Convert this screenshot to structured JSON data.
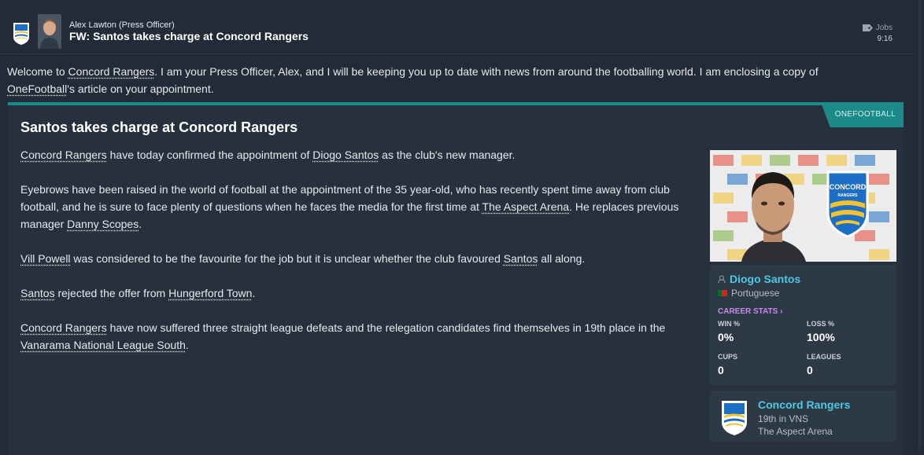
{
  "header": {
    "sender": "Alex Lawton  (Press Officer)",
    "subject": "FW: Santos takes charge at Concord Rangers",
    "jobs_label": "Jobs",
    "time": "9:16"
  },
  "intro": {
    "t1": "Welcome to ",
    "club": "Concord Rangers",
    "t2": ". I am your Press Officer, Alex, and I will be keeping you up to date with news from around the footballing world. I am enclosing a copy of ",
    "source": "OneFootball",
    "t3": "'s article on your appointment."
  },
  "article": {
    "source_tag": "ONEFOOTBALL",
    "title": "Santos takes charge at Concord Rangers",
    "p1": {
      "club": "Concord Rangers",
      "a": " have today confirmed the appointment of ",
      "manager": "Diogo Santos",
      "b": " as the club's new manager."
    },
    "p2": {
      "a": "Eyebrows have been raised in the world of football at the appointment of the 35 year-old, who has recently spent time away from club football, and he is sure to face plenty of questions when he faces the media for the first time at ",
      "stadium": "The Aspect Arena",
      "b": ". He replaces previous manager ",
      "prev": "Danny Scopes",
      "c": "."
    },
    "p3": {
      "person": "Vill Powell",
      "a": " was considered to be the favourite for the job but it is unclear whether the club favoured ",
      "manager": "Santos",
      "b": " all along."
    },
    "p4": {
      "manager": "Santos",
      "a": " rejected the offer from ",
      "club": "Hungerford Town",
      "b": "."
    },
    "p5": {
      "club": "Concord Rangers",
      "a": " have now suffered three straight league defeats and the relegation candidates find themselves in 19th place in the ",
      "league": "Vanarama National League South",
      "b": "."
    }
  },
  "player_card": {
    "name": "Diogo Santos",
    "nationality": "Portuguese",
    "career_stats_label": "CAREER STATS",
    "win_label": "WIN %",
    "win_value": "0%",
    "loss_label": "LOSS %",
    "loss_value": "100%",
    "cups_label": "CUPS",
    "cups_value": "0",
    "leagues_label": "LEAGUES",
    "leagues_value": "0"
  },
  "club_card": {
    "name": "Concord Rangers",
    "position": "19th in VNS",
    "stadium": "The Aspect Arena"
  },
  "badge_text": {
    "top": "CONCORD",
    "bottom": "RANGERS"
  },
  "colors": {
    "accent_teal": "#1d8a8a",
    "link_blue": "#4fc8e6",
    "stats_purple": "#c48ce8",
    "badge_blue": "#1c6fc4",
    "badge_yellow": "#f2c230"
  }
}
